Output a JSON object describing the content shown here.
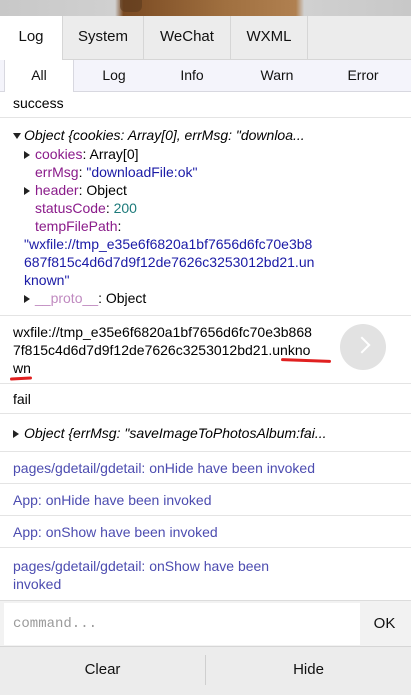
{
  "tabs": [
    "Log",
    "System",
    "WeChat",
    "WXML"
  ],
  "subtabs": [
    "All",
    "Log",
    "Info",
    "Warn",
    "Error"
  ],
  "log": {
    "success": "success",
    "object_summary": "Object {cookies: Array[0], errMsg: \"downloa...",
    "cookies_key": "cookies",
    "cookies_val": ": Array[0]",
    "errmsg_key": "errMsg",
    "errmsg_val": "\"downloadFile:ok\"",
    "header_key": "header",
    "header_val": ": Object",
    "status_key": "statusCode",
    "status_val": "200",
    "temp_key": "tempFilePath",
    "temp_val_lines": [
      "\"wxfile://tmp_e35e6f6820a1bf7656d6fc70e3b8",
      "687f815c4d6d7d9f12de7626c3253012bd21.un",
      "known\""
    ],
    "proto_key": "__proto__",
    "proto_val": ": Object",
    "path_line1": "wxfile://tmp_e35e6f6820a1bf7656d6fc70e3b868",
    "path_line2": "7f815c4d6d7d9f12de7626c3253012bd21.unkno",
    "path_line3": "wn",
    "fail": "fail",
    "fail_object": "Object {errMsg: \"saveImageToPhotosAlbum:fai...",
    "info1": "pages/gdetail/gdetail: onHide have been invoked",
    "info2": "App: onHide have been invoked",
    "info3": "App: onShow have been invoked",
    "info4_line1": "pages/gdetail/gdetail: onShow have been",
    "info4_line2": "invoked"
  },
  "command": {
    "placeholder": "command...",
    "value": ""
  },
  "ok_label": "OK",
  "bottom": {
    "clear": "Clear",
    "hide": "Hide"
  },
  "colors": {
    "key": "#8a1b8a",
    "string": "#1a1aa6",
    "number": "#1c7a7a",
    "info": "#4c4cb0",
    "annotation": "#e02020"
  }
}
